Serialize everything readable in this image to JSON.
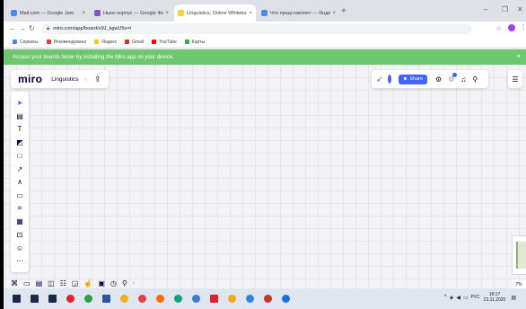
{
  "browser": {
    "tabs": [
      {
        "title": "Mail.com — Google Jam",
        "color": "#4a8af4"
      },
      {
        "title": "Ньюс-корпус — Google Форма",
        "color": "#7e57c2"
      },
      {
        "title": "Linguistics, Online Whiteboard f",
        "color": "#ffd02f"
      },
      {
        "title": "Что представляет — Яндекс",
        "color": "#4a8af4"
      }
    ],
    "active_tab_index": 2,
    "new_tab": "+",
    "address": "miro.com/app/board/o9J_kgwU5o=/",
    "bookmarks": [
      {
        "label": "Сервисы",
        "color": "#4285f4"
      },
      {
        "label": "Рекомендовано",
        "color": "#e53935"
      },
      {
        "label": "Яндекс",
        "color": "#fbc02d"
      },
      {
        "label": "Gmail",
        "color": "#d93025"
      },
      {
        "label": "YouTube",
        "color": "#ff0000"
      },
      {
        "label": "Карты",
        "color": "#34a853"
      }
    ]
  },
  "banner": {
    "text": "Access your boards faster by installing the Miro app on your device.",
    "close": "×"
  },
  "miro": {
    "logo": "miro",
    "board_name": "Linguistics",
    "share_label": "Share",
    "colors": {
      "accent": "#4262ff",
      "avatar": "#f24726",
      "banner": "#6dc86d"
    },
    "tools": [
      {
        "icon": "cursor-icon",
        "glyph": "➤"
      },
      {
        "icon": "template-icon",
        "glyph": "▤"
      },
      {
        "icon": "text-icon",
        "glyph": "T"
      },
      {
        "icon": "sticky-note-icon",
        "glyph": "◩"
      },
      {
        "icon": "shape-icon",
        "glyph": "□"
      },
      {
        "icon": "connection-line-icon",
        "glyph": "↗"
      },
      {
        "icon": "pen-icon",
        "glyph": "∧"
      },
      {
        "icon": "comment-icon",
        "glyph": "▭"
      },
      {
        "icon": "frame-icon",
        "glyph": "⌗"
      },
      {
        "icon": "table-icon",
        "glyph": "▦"
      },
      {
        "icon": "upload-icon",
        "glyph": "⊡"
      },
      {
        "icon": "emoji-icon",
        "glyph": "☺"
      },
      {
        "icon": "more-tools-icon",
        "glyph": "⋯"
      }
    ],
    "bottom_tools": [
      {
        "icon": "frames-panel-icon",
        "glyph": "⌘"
      },
      {
        "icon": "comments-panel-icon",
        "glyph": "▭"
      },
      {
        "icon": "chat-icon",
        "glyph": "▤"
      },
      {
        "icon": "screen-share-icon",
        "glyph": "◫"
      },
      {
        "icon": "cards-icon",
        "glyph": "☷"
      },
      {
        "icon": "timer-icon",
        "glyph": "◲"
      },
      {
        "icon": "vote-icon",
        "glyph": "☝"
      },
      {
        "icon": "video-icon",
        "glyph": "▣"
      },
      {
        "icon": "history-icon",
        "glyph": "◷"
      },
      {
        "icon": "activity-icon",
        "glyph": "⚲"
      }
    ],
    "zoom_label": "7%"
  },
  "taskbar": {
    "apps": [
      {
        "icon": "windows-start-icon",
        "color": "#1a2a4a"
      },
      {
        "icon": "search-icon",
        "color": "#1a2a4a"
      },
      {
        "icon": "task-view-icon",
        "color": "#1a2a4a"
      },
      {
        "icon": "opera-icon",
        "color": "#e0202a"
      },
      {
        "icon": "chrome-icon",
        "color": "#2f9e44"
      },
      {
        "icon": "word-icon",
        "color": "#2b579a"
      },
      {
        "icon": "file-explorer-icon",
        "color": "#f2b01e"
      },
      {
        "icon": "app-icon",
        "color": "#e83e3e"
      },
      {
        "icon": "app-icon",
        "color": "#ff6a00"
      },
      {
        "icon": "app-icon",
        "color": "#12a37a"
      },
      {
        "icon": "app-icon",
        "color": "#3a7bd5"
      },
      {
        "icon": "yandex-icon",
        "color": "#e0202a"
      },
      {
        "icon": "app-icon",
        "color": "#f5a623"
      },
      {
        "icon": "app-icon",
        "color": "#2e86de"
      },
      {
        "icon": "app-icon",
        "color": "#c0392b"
      },
      {
        "icon": "app-icon",
        "color": "#1e6fd9"
      }
    ],
    "lang": "РУС",
    "time": "18:17",
    "date": "23.11.2020"
  }
}
